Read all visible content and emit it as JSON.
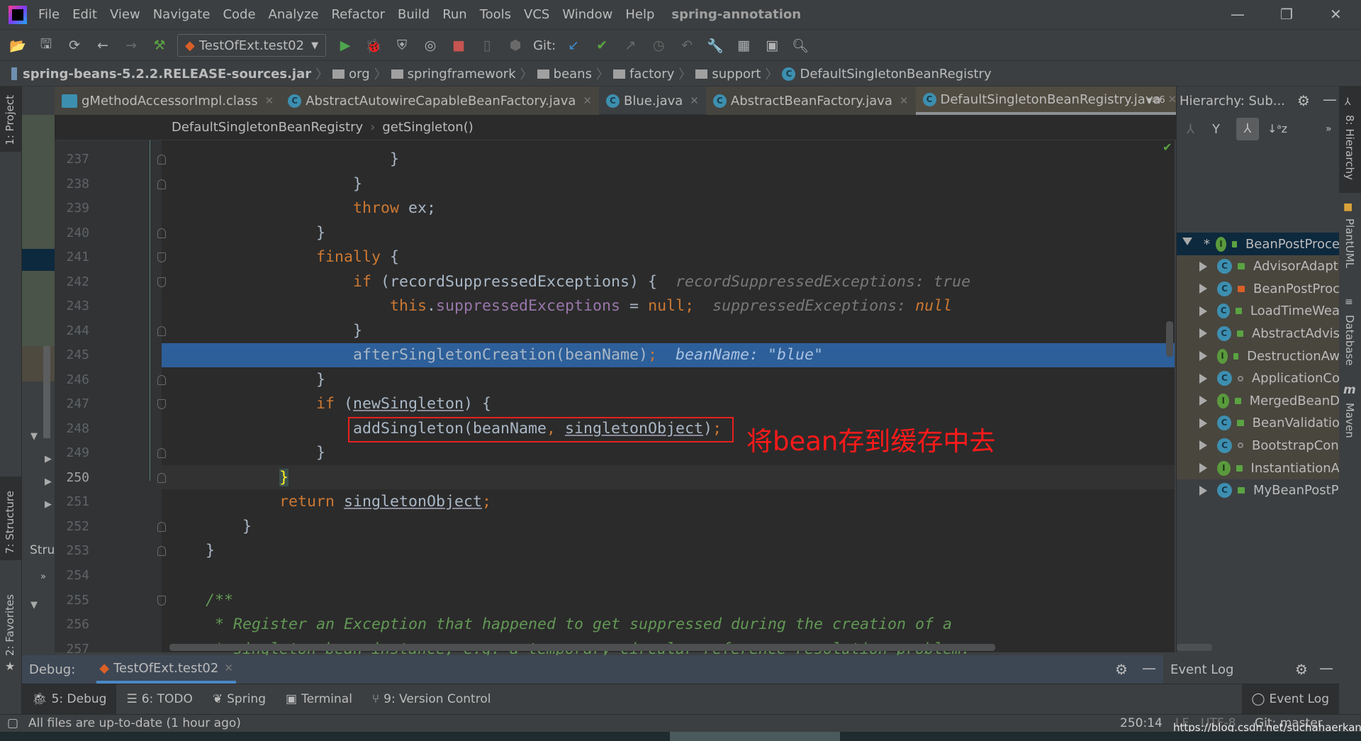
{
  "app": {
    "title": "spring-annotation",
    "menu": [
      "File",
      "Edit",
      "View",
      "Navigate",
      "Code",
      "Analyze",
      "Refactor",
      "Build",
      "Run",
      "Tools",
      "VCS",
      "Window",
      "Help"
    ]
  },
  "toolbar": {
    "run_config": "TestOfExt.test02",
    "git_label": "Git:"
  },
  "navbar": {
    "items": [
      "spring-beans-5.2.2.RELEASE-sources.jar",
      "org",
      "springframework",
      "beans",
      "factory",
      "support",
      "DefaultSingletonBeanRegistry"
    ]
  },
  "tabs": [
    {
      "label": "gMethodAccessorImpl.class",
      "lib": true
    },
    {
      "label": "AbstractAutowireCapableBeanFactory.java",
      "lib": true
    },
    {
      "label": "Blue.java",
      "lib": false
    },
    {
      "label": "AbstractBeanFactory.java",
      "lib": true
    },
    {
      "label": "DefaultSingletonBeanRegistry.java",
      "lib": true,
      "active": true
    }
  ],
  "tabs_overflow": "6",
  "editor_breadcrumb": [
    "DefaultSingletonBeanRegistry",
    "getSingleton()"
  ],
  "code": {
    "current_line": 250,
    "execution_line": 245,
    "lines": [
      {
        "n": 237,
        "i": 24,
        "t": [
          [
            "}",
            ""
          ]
        ]
      },
      {
        "n": 238,
        "i": 20,
        "t": [
          [
            "}",
            ""
          ]
        ]
      },
      {
        "n": 239,
        "i": 20,
        "t": [
          [
            "throw",
            "kw"
          ],
          [
            " ex;",
            ""
          ]
        ]
      },
      {
        "n": 240,
        "i": 16,
        "t": [
          [
            "}",
            ""
          ]
        ]
      },
      {
        "n": 241,
        "i": 16,
        "t": [
          [
            "finally",
            "kw"
          ],
          [
            " {",
            ""
          ]
        ]
      },
      {
        "n": 242,
        "i": 20,
        "t": [
          [
            "if",
            "kw"
          ],
          [
            " (recordSuppressedExceptions) {  ",
            ""
          ],
          [
            "recordSuppressedExceptions: true",
            "hint"
          ]
        ]
      },
      {
        "n": 243,
        "i": 24,
        "t": [
          [
            "this",
            "kw"
          ],
          [
            ".",
            ""
          ],
          [
            "suppressedExceptions",
            "fld"
          ],
          [
            " = ",
            ""
          ],
          [
            "null",
            "kw"
          ],
          [
            ";",
            "kw"
          ],
          [
            "  suppressedExceptions: ",
            "hint"
          ],
          [
            "null",
            "hintv"
          ]
        ]
      },
      {
        "n": 244,
        "i": 20,
        "t": [
          [
            "}",
            ""
          ]
        ]
      },
      {
        "n": 245,
        "i": 20,
        "t": [
          [
            "afterSingletonCreation(beanName)",
            ""
          ],
          [
            ";",
            "kw"
          ],
          [
            "  beanName: \"blue\"",
            "dbg"
          ]
        ]
      },
      {
        "n": 246,
        "i": 16,
        "t": [
          [
            "}",
            ""
          ]
        ]
      },
      {
        "n": 247,
        "i": 16,
        "t": [
          [
            "if",
            "kw"
          ],
          [
            " (",
            ""
          ],
          [
            "newSingleton",
            "ul"
          ],
          [
            ") {",
            ""
          ]
        ]
      },
      {
        "n": 248,
        "i": 20,
        "t": [
          [
            "addSingleton(beanName",
            ""
          ],
          [
            ", ",
            "kw"
          ],
          [
            "singletonObject",
            "ul"
          ],
          [
            ")",
            ""
          ],
          [
            ";",
            "kw"
          ]
        ]
      },
      {
        "n": 249,
        "i": 16,
        "t": [
          [
            "}",
            ""
          ]
        ]
      },
      {
        "n": 250,
        "i": 12,
        "t": [
          [
            "}",
            "bhl"
          ]
        ]
      },
      {
        "n": 251,
        "i": 12,
        "t": [
          [
            "return",
            "kw"
          ],
          [
            " ",
            ""
          ],
          [
            "singletonObject",
            "ul"
          ],
          [
            ";",
            "kw"
          ]
        ]
      },
      {
        "n": 252,
        "i": 8,
        "t": [
          [
            "}",
            ""
          ]
        ]
      },
      {
        "n": 253,
        "i": 4,
        "t": [
          [
            "}",
            ""
          ]
        ]
      },
      {
        "n": 254,
        "i": 0,
        "t": []
      },
      {
        "n": 255,
        "i": 4,
        "t": [
          [
            "/**",
            "cmt"
          ]
        ]
      },
      {
        "n": 256,
        "i": 5,
        "t": [
          [
            "* Register an Exception that happened to get suppressed during the creation of a",
            "cmt"
          ]
        ]
      },
      {
        "n": 257,
        "i": 5,
        "t": [
          [
            "* singleton bean instance, e.g. a temporary circular reference resolution problem.",
            "cmt"
          ]
        ]
      }
    ]
  },
  "annotation": "将bean存到缓存中去",
  "hierarchy": {
    "title": "Hierarchy:  Sub...",
    "items": [
      {
        "label": "BeanPostProce",
        "kind": "I",
        "access": "public",
        "root": true
      },
      {
        "label": "AdvisorAdapt",
        "kind": "C",
        "access": "public"
      },
      {
        "label": "BeanPostProc",
        "kind": "C",
        "access": "private"
      },
      {
        "label": "LoadTimeWea",
        "kind": "C",
        "access": "public"
      },
      {
        "label": "AbstractAdvis",
        "kind": "C",
        "access": "public"
      },
      {
        "label": "DestructionAw",
        "kind": "I",
        "access": "public"
      },
      {
        "label": "ApplicationCo",
        "kind": "C",
        "access": "package"
      },
      {
        "label": "MergedBeanD",
        "kind": "I",
        "access": "public"
      },
      {
        "label": "BeanValidatio",
        "kind": "C",
        "access": "public"
      },
      {
        "label": "BootstrapCon",
        "kind": "C",
        "access": "package"
      },
      {
        "label": "InstantiationA",
        "kind": "I",
        "access": "public"
      },
      {
        "label": "MyBeanPostP",
        "kind": "C",
        "access": "public",
        "project": true
      }
    ]
  },
  "left_strip": [
    "1: Project",
    "7: Structure",
    "2: Favorites"
  ],
  "left_panel_label": "Stru",
  "right_strip": [
    "8: Hierarchy",
    "PlantUML",
    "Database",
    "Maven"
  ],
  "debug": {
    "label": "Debug:",
    "session": "TestOfExt.test02",
    "event_log": "Event Log"
  },
  "toolwindows": [
    "5: Debug",
    "6: TODO",
    "Spring",
    "Terminal",
    "9: Version Control"
  ],
  "toolwindow_right": "Event Log",
  "status": {
    "message": "All files are up-to-date (1 hour ago)",
    "position": "250:14",
    "line_sep": "LF",
    "encoding": "UTF-8",
    "git": "Git: master",
    "watermark": "https://blog.csdn.net/suchahaerkang"
  }
}
